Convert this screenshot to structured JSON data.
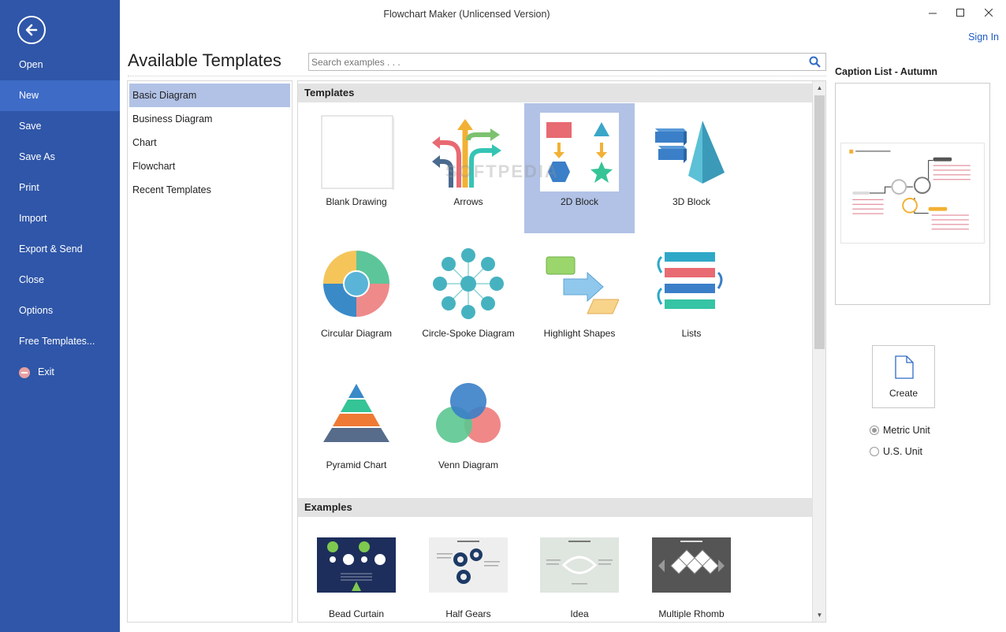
{
  "window": {
    "title": "Flowchart Maker (Unlicensed Version)",
    "sign_in": "Sign In"
  },
  "sidebar": {
    "items": [
      {
        "label": "Open"
      },
      {
        "label": "New"
      },
      {
        "label": "Save"
      },
      {
        "label": "Save As"
      },
      {
        "label": "Print"
      },
      {
        "label": "Import"
      },
      {
        "label": "Export & Send"
      },
      {
        "label": "Close"
      },
      {
        "label": "Options"
      },
      {
        "label": "Free Templates..."
      },
      {
        "label": "Exit"
      }
    ],
    "active": "New"
  },
  "main": {
    "heading": "Available Templates",
    "search_placeholder": "Search examples . . .",
    "categories": [
      {
        "label": "Basic Diagram"
      },
      {
        "label": "Business Diagram"
      },
      {
        "label": "Chart"
      },
      {
        "label": "Flowchart"
      },
      {
        "label": "Recent Templates"
      }
    ],
    "templates_header": "Templates",
    "templates": [
      {
        "label": "Blank Drawing"
      },
      {
        "label": "Arrows"
      },
      {
        "label": "2D Block"
      },
      {
        "label": "3D Block"
      },
      {
        "label": "Circular Diagram"
      },
      {
        "label": "Circle-Spoke Diagram"
      },
      {
        "label": "Highlight Shapes"
      },
      {
        "label": "Lists"
      },
      {
        "label": "Pyramid Chart"
      },
      {
        "label": "Venn Diagram"
      }
    ],
    "selected_template": "2D Block",
    "examples_header": "Examples",
    "examples": [
      {
        "label": "Bead Curtain"
      },
      {
        "label": "Half Gears"
      },
      {
        "label": "Idea"
      },
      {
        "label": "Multiple Rhomb"
      }
    ],
    "watermark": "SOFTPEDIA"
  },
  "right_panel": {
    "preview_title": "Caption List - Autumn",
    "create_label": "Create",
    "units": [
      {
        "label": "Metric Unit",
        "checked": true
      },
      {
        "label": "U.S. Unit",
        "checked": false
      }
    ]
  },
  "colors": {
    "sidebar": "#2f56a8",
    "sidebar_active": "#3d6bc6",
    "selection": "#b1c2e6",
    "link": "#1e5bc6"
  }
}
